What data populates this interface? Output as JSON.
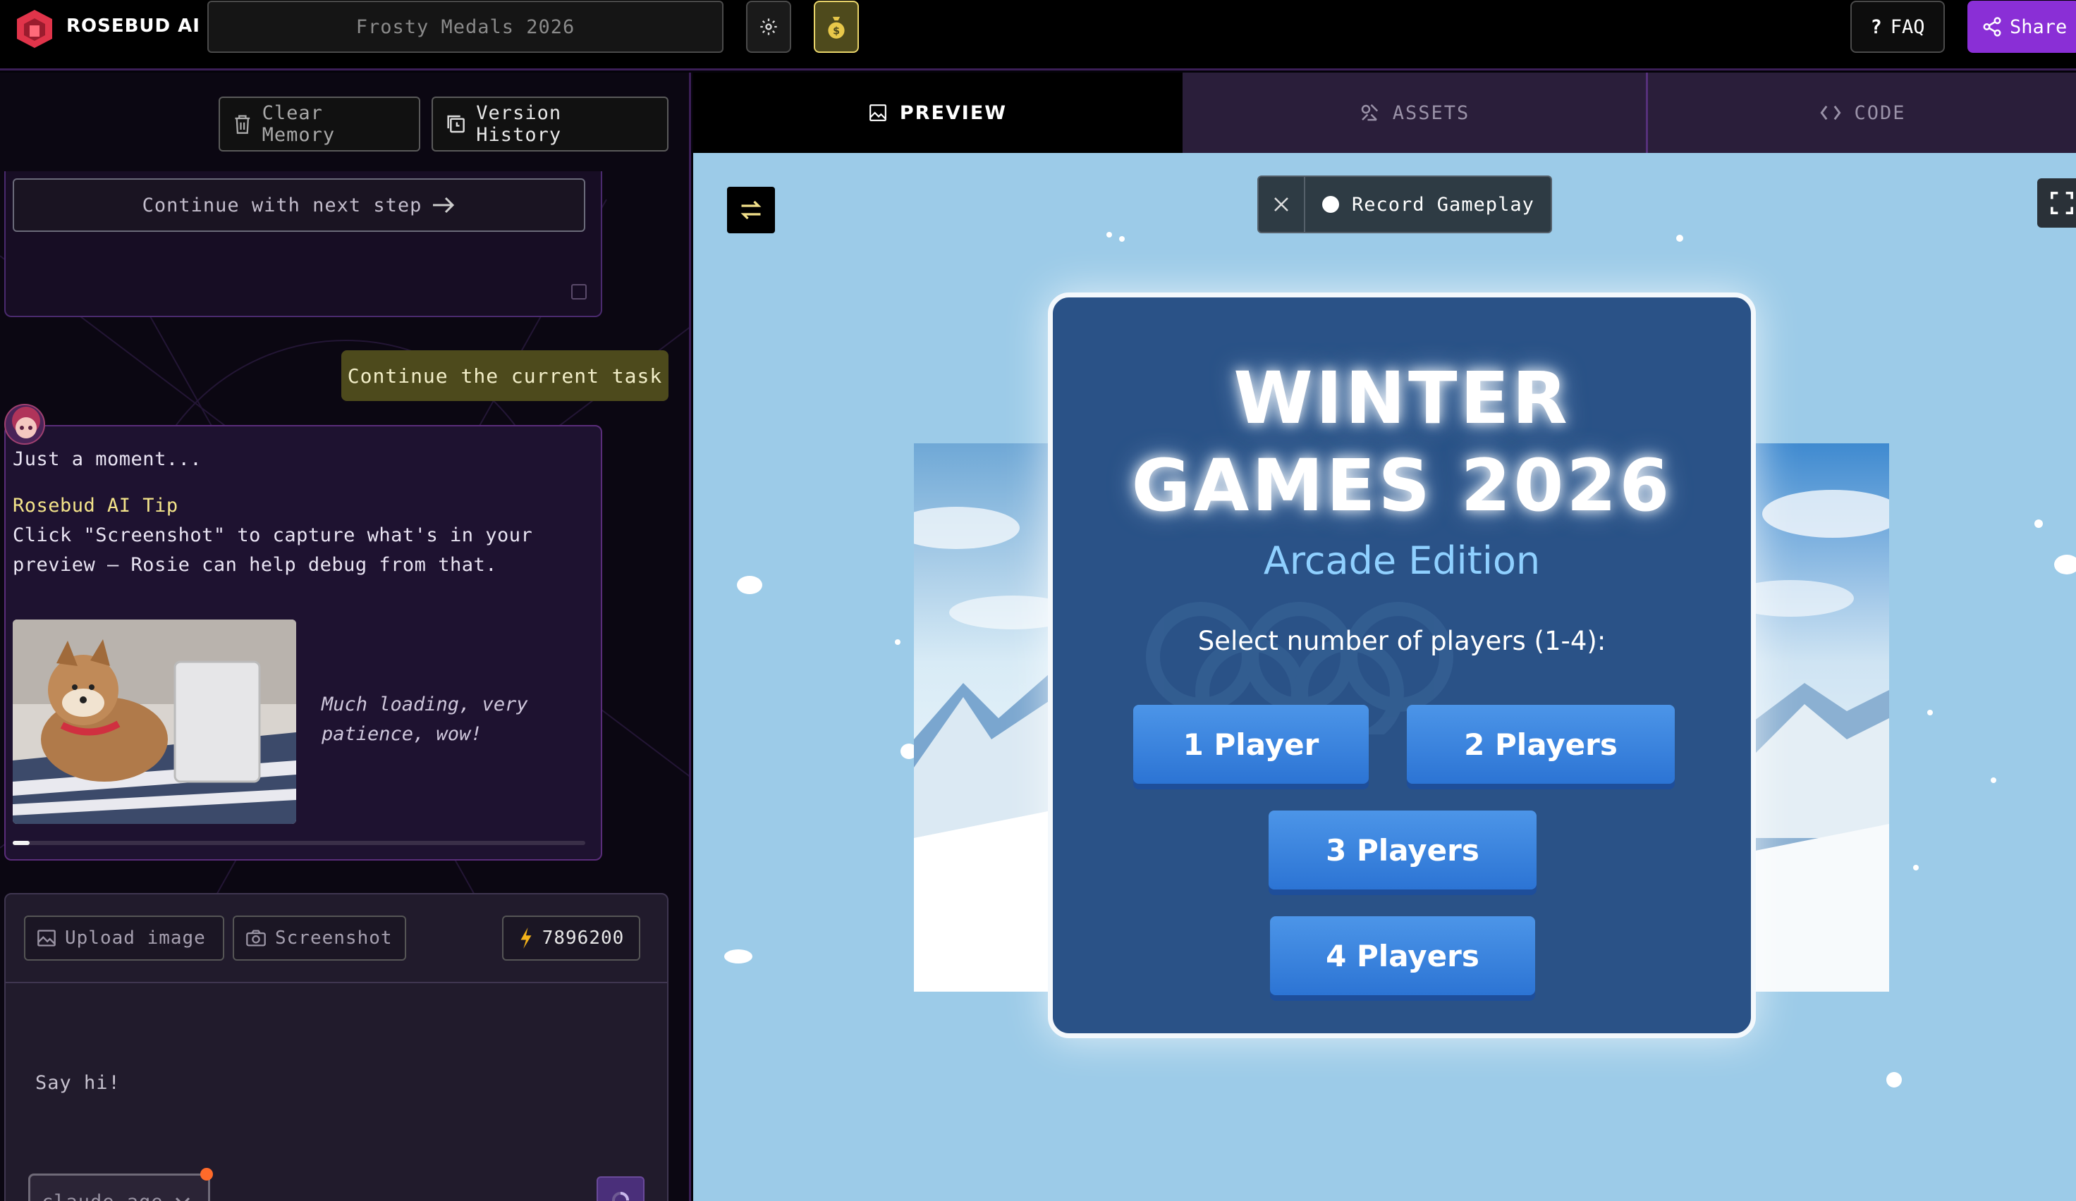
{
  "brand": {
    "name": "ROSEBUD AI"
  },
  "project": {
    "title": "Frosty Medals 2026"
  },
  "topbar": {
    "faq_label": "FAQ",
    "share_label": "Share"
  },
  "chat": {
    "clear_memory": "Clear Memory",
    "version_history": "Version History",
    "continue_next_step": "Continue with next step",
    "user_message": "Continue the current task",
    "bot": {
      "status": "Just a moment...",
      "tip_title": "Rosebud AI Tip",
      "tip_line1": "Click \"Screenshot\" to capture what's in your",
      "tip_line2": "preview — Rosie can help debug from that.",
      "loading_line1": "Much loading, very",
      "loading_line2": "patience, wow!",
      "progress": 0.03
    },
    "composer": {
      "upload_image": "Upload image",
      "screenshot": "Screenshot",
      "credits": "7896200",
      "placeholder": "Say hi!",
      "model": "claude-age"
    }
  },
  "tabs": [
    {
      "label": "PREVIEW",
      "active": true
    },
    {
      "label": "ASSETS",
      "active": false
    },
    {
      "label": "CODE",
      "active": false
    }
  ],
  "preview": {
    "record_label": "Record Gameplay",
    "game": {
      "title_line1": "WINTER",
      "title_line2": "GAMES 2026",
      "subtitle": "Arcade Edition",
      "prompt": "Select number of players (1-4):",
      "buttons": [
        "1 Player",
        "2 Players",
        "3 Players",
        "4 Players"
      ]
    }
  },
  "colors": {
    "accent_purple": "#8a2fd6",
    "user_bubble": "#4d4a1c",
    "preview_bg": "#9ccbe8",
    "modal_bg": "#2a5287",
    "button_blue": "#3a85de"
  }
}
